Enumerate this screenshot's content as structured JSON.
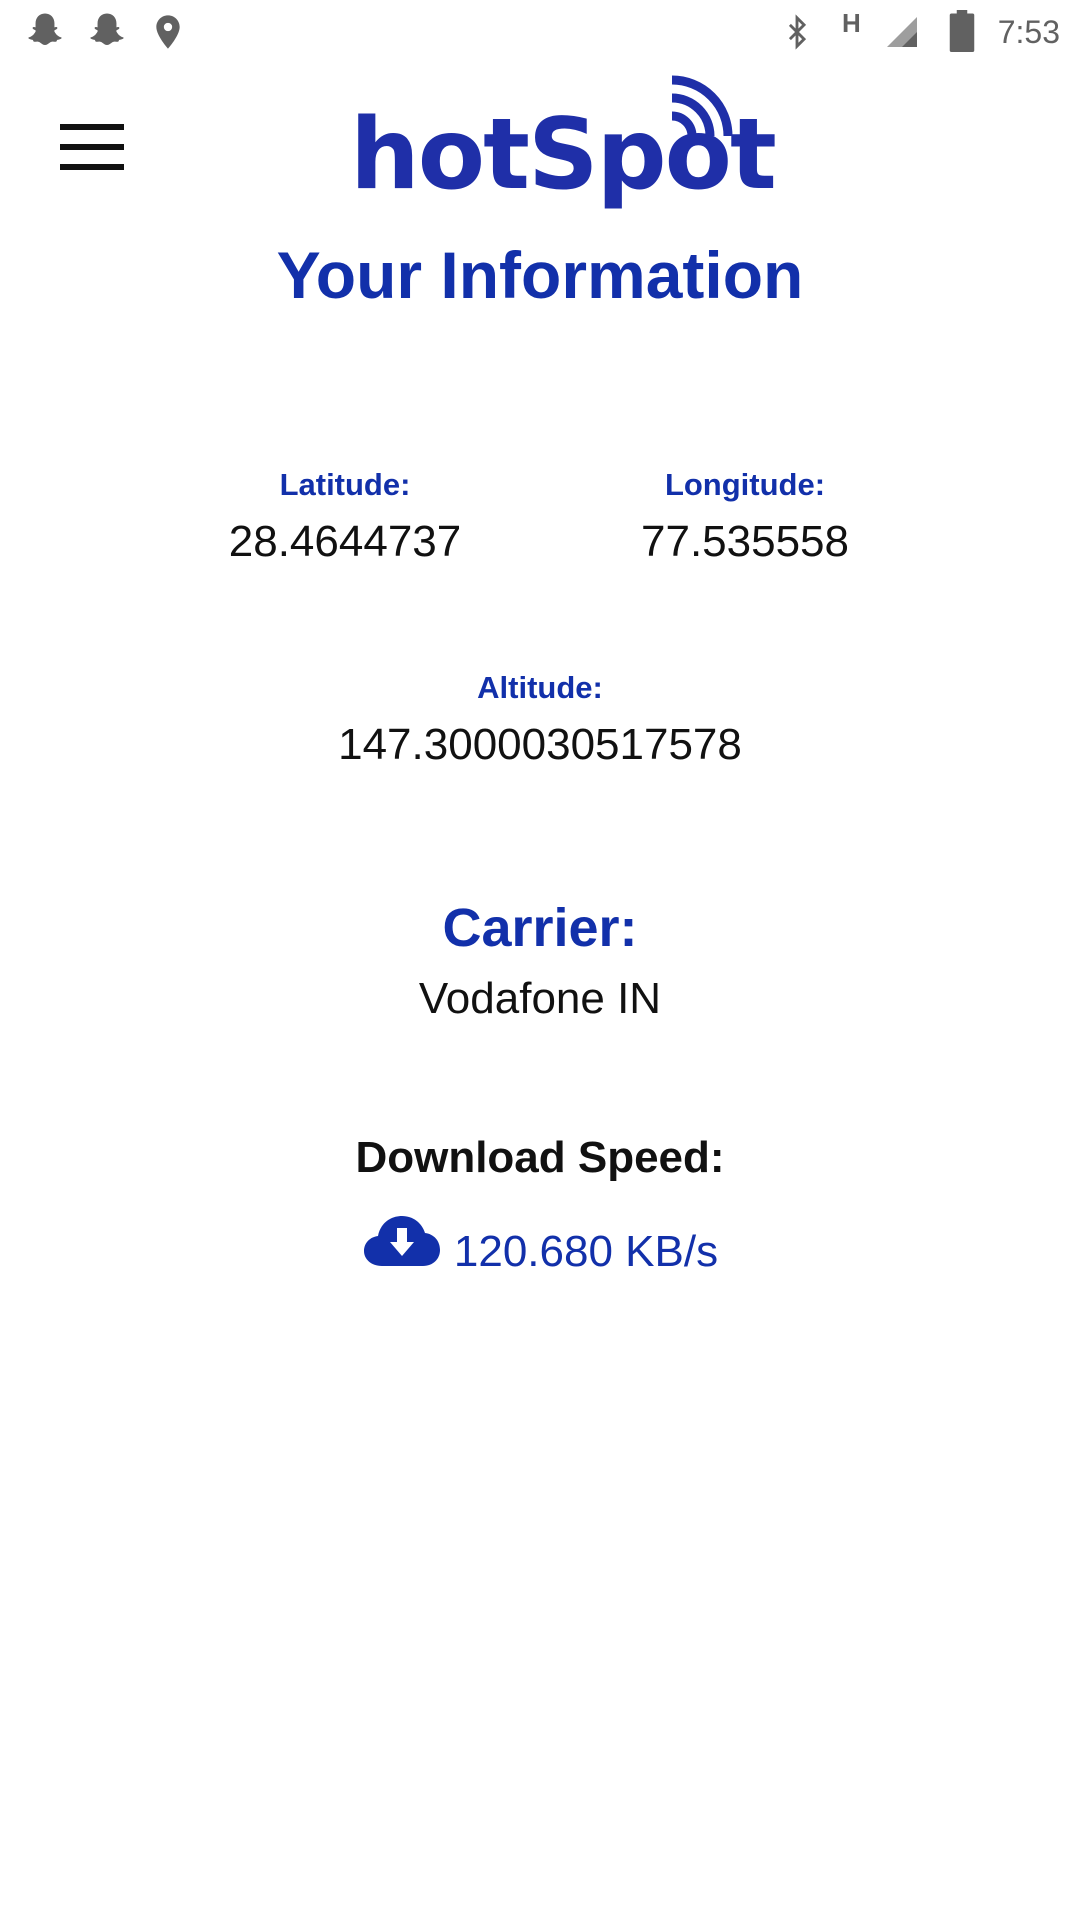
{
  "status_bar": {
    "left_icons": [
      "snapchat-ghost-icon",
      "snapchat-ghost-icon",
      "location-pin-icon"
    ],
    "right_icons": [
      "bluetooth-icon",
      "network-h-icon",
      "signal-icon",
      "battery-icon"
    ],
    "network_type": "H",
    "time": "7:53"
  },
  "header": {
    "menu_icon": "hamburger-menu-icon",
    "logo_text": "hotSpot",
    "logo_icon": "wifi-signal-icon"
  },
  "page": {
    "title": "Your Information"
  },
  "location": {
    "latitude_label": "Latitude:",
    "latitude_value": "28.4644737",
    "longitude_label": "Longitude:",
    "longitude_value": "77.535558",
    "altitude_label": "Altitude:",
    "altitude_value": "147.3000030517578"
  },
  "carrier": {
    "label": "Carrier:",
    "value": "Vodafone IN"
  },
  "download": {
    "label": "Download Speed:",
    "icon": "cloud-download-icon",
    "value": "120.680 KB/s"
  },
  "colors": {
    "accent": "#1230aa",
    "logo": "#1f2fa8",
    "text": "#111111",
    "status_icons": "#616161"
  }
}
